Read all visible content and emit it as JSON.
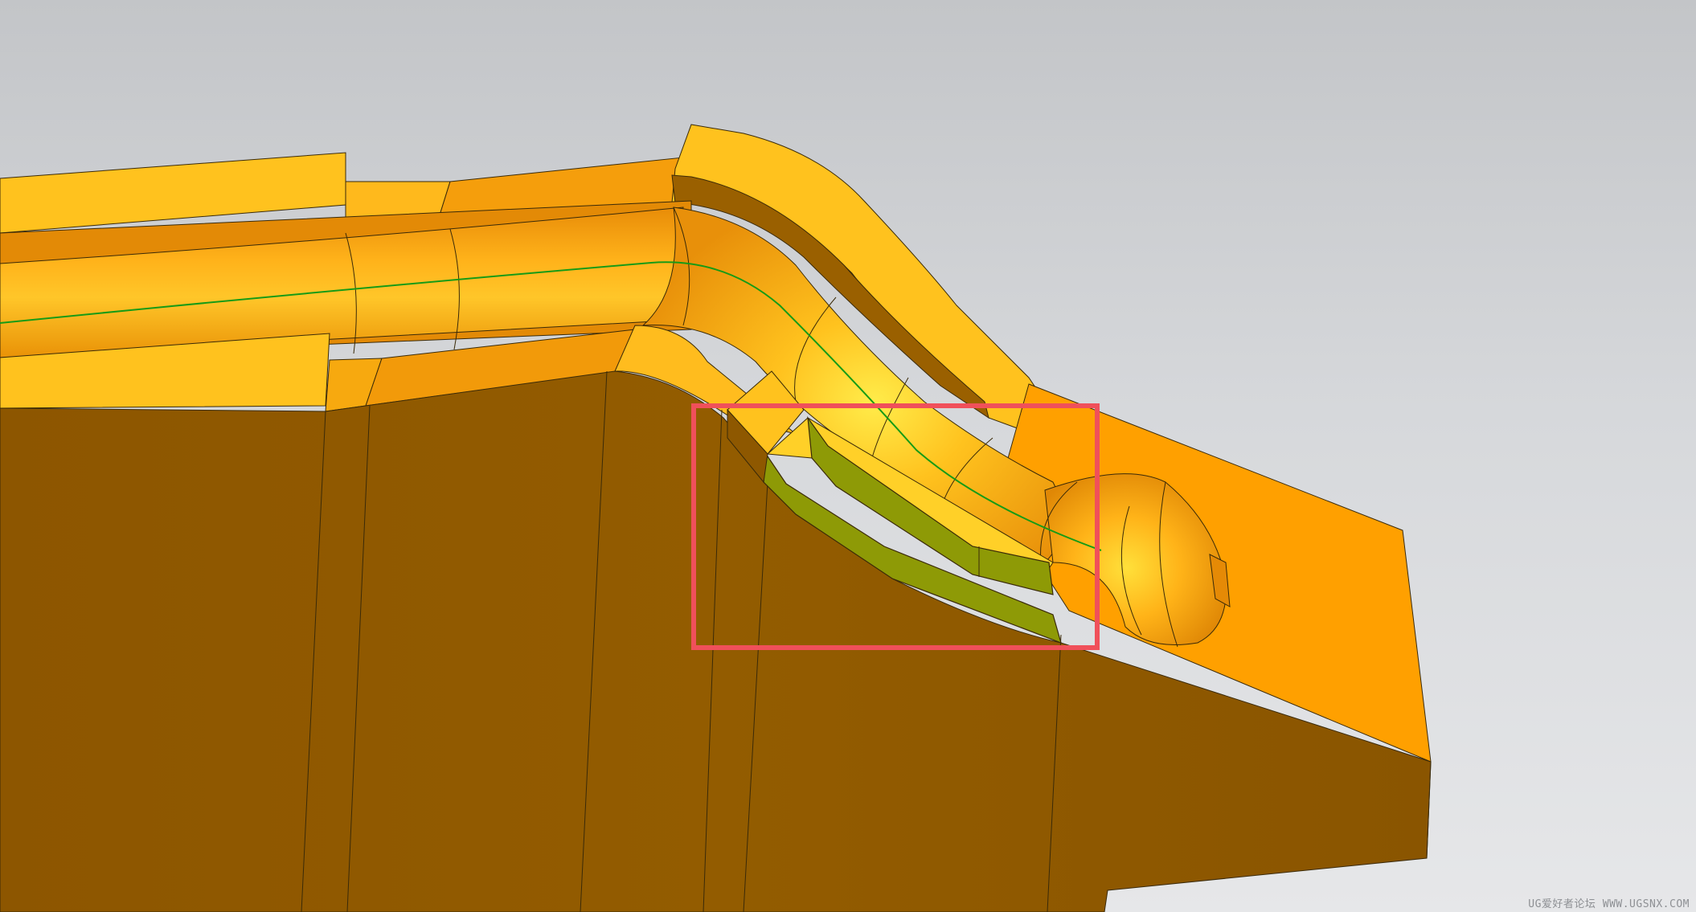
{
  "viewport": {
    "background_top": "#c3c5c8",
    "background_bottom": "#e6e7e9"
  },
  "model": {
    "colors": {
      "face_light": "#ffc21e",
      "face_mid": "#fca70a",
      "face_orange": "#ffa000",
      "face_shadow": "#e58a06",
      "face_dark": "#8e5800",
      "highlight": "#ffe23a",
      "selected_face": "#8e9a06",
      "edge": "#3a2a08",
      "centerline": "#169b16",
      "highlight_box": "#f0505a"
    }
  },
  "watermark": {
    "text": "UG爱好者论坛 WWW.UGSNX.COM"
  }
}
